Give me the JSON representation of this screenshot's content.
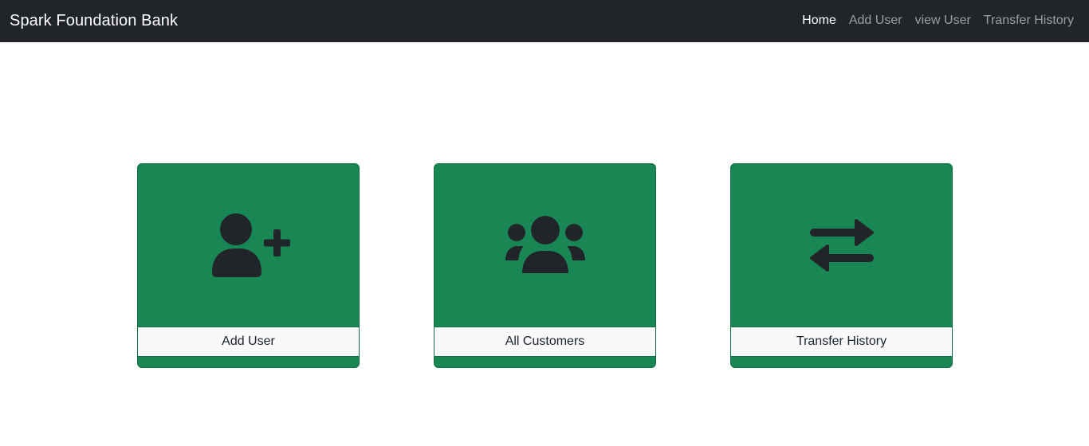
{
  "navbar": {
    "brand": "Spark Foundation Bank",
    "links": [
      {
        "label": "Home",
        "active": true
      },
      {
        "label": "Add User",
        "active": false
      },
      {
        "label": "view User",
        "active": false
      },
      {
        "label": "Transfer History",
        "active": false
      }
    ]
  },
  "cards": [
    {
      "label": "Add User",
      "icon": "user-plus-icon"
    },
    {
      "label": "All Customers",
      "icon": "users-group-icon"
    },
    {
      "label": "Transfer History",
      "icon": "arrows-exchange-icon"
    }
  ],
  "colors": {
    "navbar_bg": "#212529",
    "card_green": "#198754",
    "label_bg": "#f8f9fa",
    "icon_dark": "#212529"
  }
}
